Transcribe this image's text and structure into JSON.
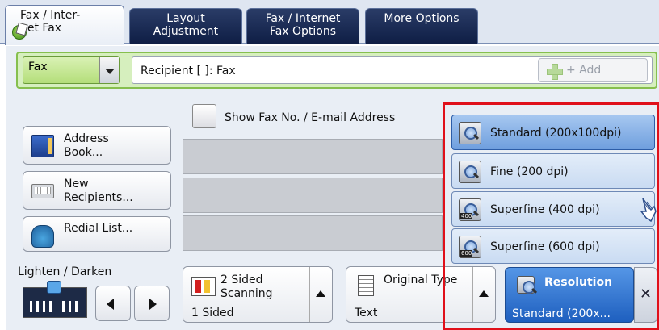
{
  "tabs": [
    {
      "line1": "Fax / Inter-",
      "line2": "net Fax"
    },
    {
      "line1": "Layout",
      "line2": "Adjustment"
    },
    {
      "line1": "Fax / Internet",
      "line2": "Fax Options"
    },
    {
      "line1": "More Options",
      "line2": ""
    }
  ],
  "recipient": {
    "type_select": "Fax",
    "field_text": "Recipient [   ]: Fax",
    "add_label": "+ Add"
  },
  "show_fax_label": "Show Fax No. / E-mail Address",
  "left_buttons": {
    "address_book": {
      "line1": "Address",
      "line2": "Book..."
    },
    "new_recipients": {
      "line1": "New",
      "line2": "Recipients..."
    },
    "redial": {
      "line1": "Redial List...",
      "line2": ""
    }
  },
  "lighten_darken": {
    "label": "Lighten / Darken"
  },
  "cards": {
    "two_sided": {
      "line1": "2 Sided",
      "line2": "Scanning",
      "value": "1 Sided"
    },
    "original_type": {
      "title": "Original Type",
      "value": "Text"
    },
    "resolution": {
      "title": "Resolution",
      "value": "Standard (200x..."
    }
  },
  "resolution_options": [
    {
      "label": "Standard (200x100dpi)",
      "tag": ""
    },
    {
      "label": "Fine (200 dpi)",
      "tag": ""
    },
    {
      "label": "Superfine (400 dpi)",
      "tag": "400"
    },
    {
      "label": "Superfine (600 dpi)",
      "tag": "600"
    }
  ],
  "colors": {
    "highlight_frame": "#e0101a",
    "accent_blue": "#1e5fbf",
    "green_bar": "#86bf4e"
  }
}
